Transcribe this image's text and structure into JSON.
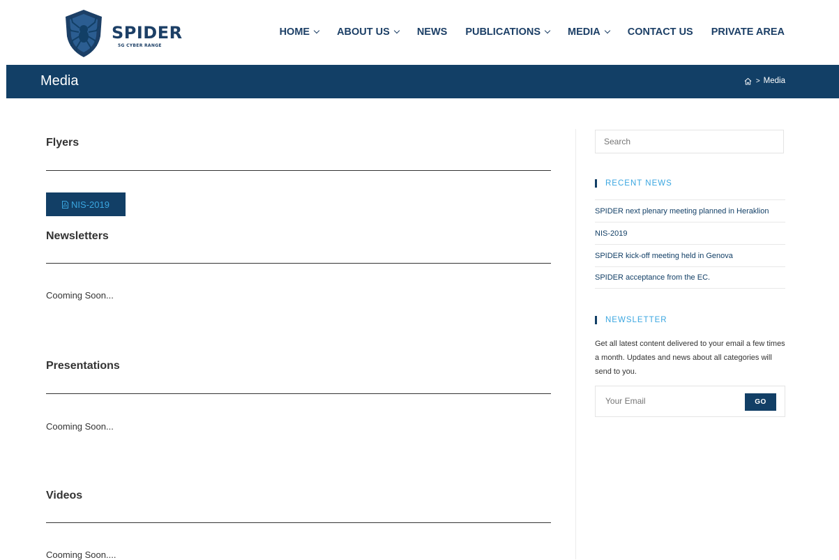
{
  "brand": {
    "name": "SPIDER",
    "tagline": "5G CYBER RANGE"
  },
  "nav": {
    "items": [
      {
        "label": "HOME",
        "dropdown": true
      },
      {
        "label": "ABOUT US",
        "dropdown": true
      },
      {
        "label": "NEWS",
        "dropdown": false
      },
      {
        "label": "PUBLICATIONS",
        "dropdown": true
      },
      {
        "label": "MEDIA",
        "dropdown": true
      },
      {
        "label": "CONTACT US",
        "dropdown": false
      },
      {
        "label": "PRIVATE AREA",
        "dropdown": false
      }
    ]
  },
  "titlebar": {
    "title": "Media",
    "breadcrumb_sep": ">",
    "breadcrumb_current": "Media"
  },
  "sections": [
    {
      "title": "Flyers",
      "button_label": "NIS-2019"
    },
    {
      "title": "Newsletters",
      "text": "Cooming Soon..."
    },
    {
      "title": "Presentations",
      "text": "Cooming Soon..."
    },
    {
      "title": "Videos",
      "text": "Cooming Soon...."
    }
  ],
  "sidebar": {
    "search_placeholder": "Search",
    "recent_news_title": "RECENT NEWS",
    "recent_news": [
      "SPIDER next plenary meeting planned in Heraklion",
      "NIS-2019",
      "SPIDER kick-off meeting held in Genova",
      "SPIDER acceptance from the EC."
    ],
    "newsletter_title": "NEWSLETTER",
    "newsletter_text": "Get all latest content delivered to your email a few times a month. Updates and news about all categories will send to you.",
    "email_placeholder": "Your Email",
    "go_label": "GO"
  },
  "colors": {
    "primary": "#123f66",
    "accent": "#3aa6e0"
  }
}
